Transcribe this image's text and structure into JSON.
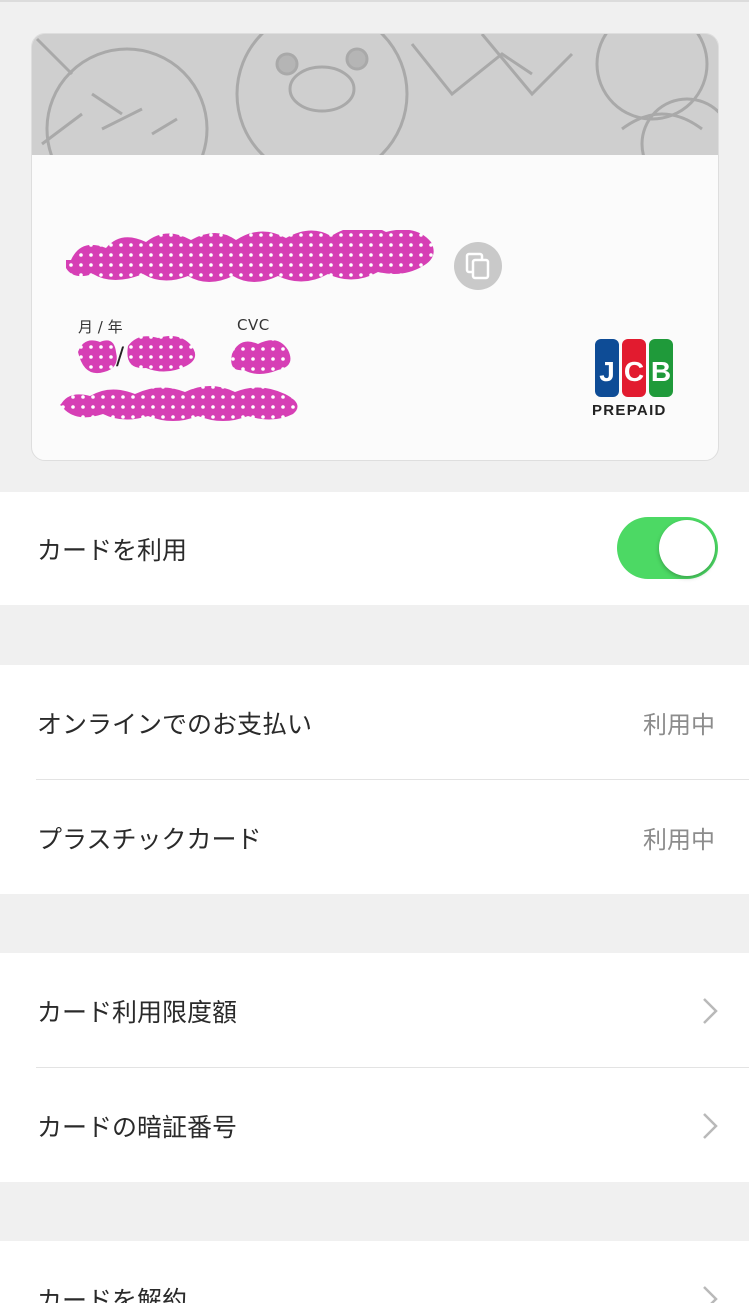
{
  "card": {
    "expiry_label": "月 / 年",
    "expiry_separator": "/",
    "cvc_label": "CVC",
    "brand_name": "JCB",
    "brand_subtitle": "PREPAID"
  },
  "colors": {
    "toggle_on": "#4cd964",
    "redaction": "#d63fb5",
    "value_text": "#8c8c8c",
    "background": "#f0f0f0"
  },
  "toggle_row": {
    "label": "カードを利用",
    "enabled": true
  },
  "status_rows": [
    {
      "label": "オンラインでのお支払い",
      "value": "利用中"
    },
    {
      "label": "プラスチックカード",
      "value": "利用中"
    }
  ],
  "settings_rows": [
    {
      "label": "カード利用限度額"
    },
    {
      "label": "カードの暗証番号"
    }
  ],
  "cancel_row": {
    "label": "カードを解約"
  },
  "icons": {
    "copy": "copy-icon",
    "chevron": "chevron-right-icon"
  }
}
